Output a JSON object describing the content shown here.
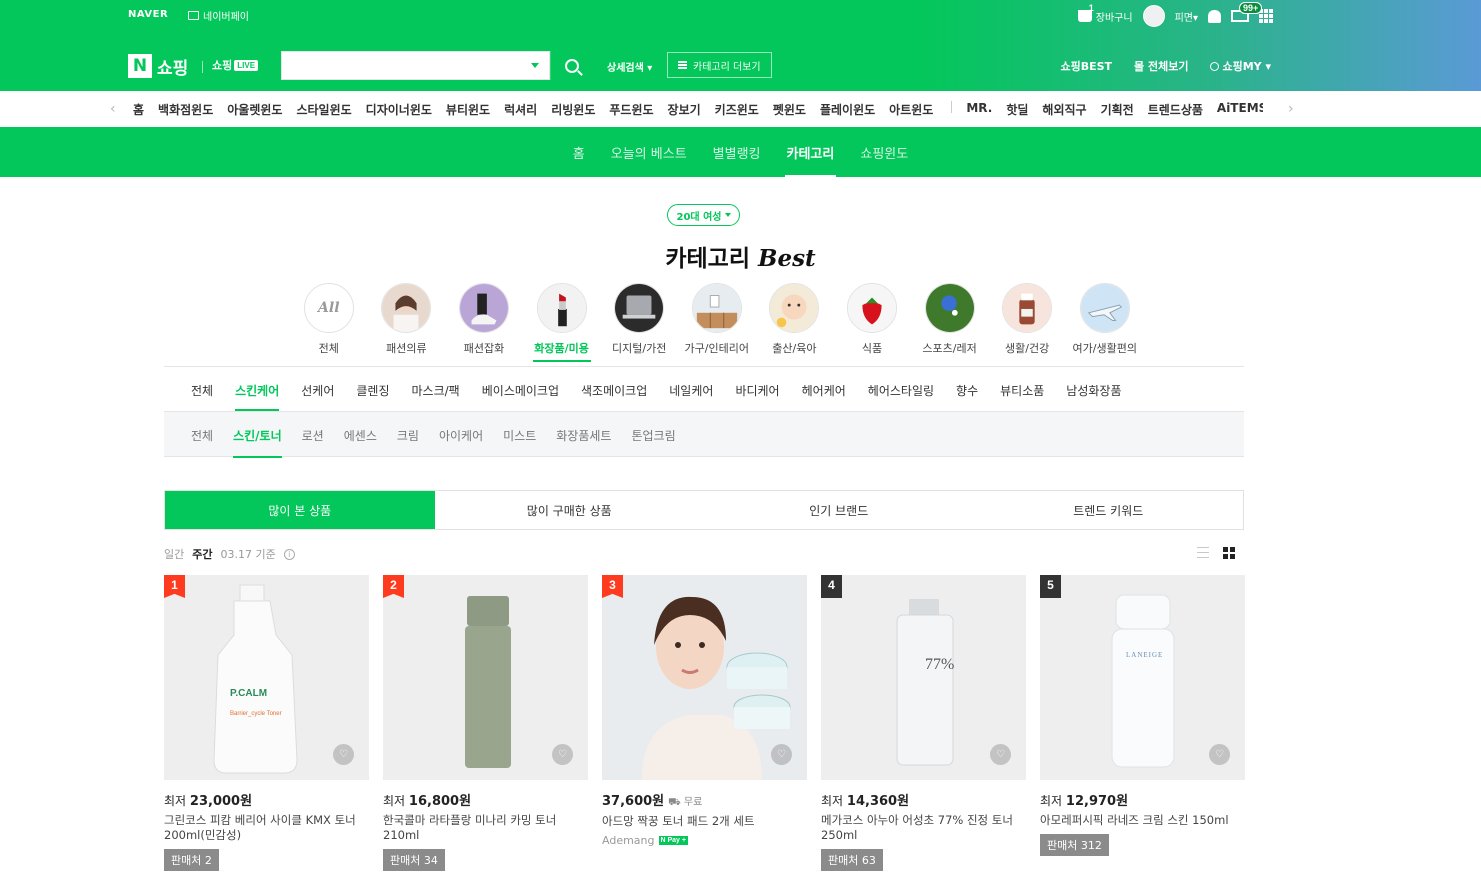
{
  "util_bar": {
    "naver_logo": "NAVER",
    "naver_pay": "네이버페이",
    "cart_label": "장바구니",
    "cart_count": "1",
    "user_name": "피면",
    "mail_badge": "99+"
  },
  "header": {
    "logo_n": "N",
    "logo_text": "쇼핑",
    "live_text": "쇼핑",
    "live_badge": "LIVE",
    "search_value": "",
    "search_placeholder": "",
    "detail_search": "상세검색",
    "category_more": "카테고리 더보기",
    "right_links": [
      "쇼핑BEST",
      "몰 전체보기",
      "쇼핑MY"
    ]
  },
  "window_nav": {
    "items_a": [
      "홈",
      "백화점윈도",
      "아울렛윈도",
      "스타일윈도",
      "디자이너윈도",
      "뷰티윈도",
      "럭셔리",
      "리빙윈도",
      "푸드윈도",
      "장보기",
      "키즈윈도",
      "펫윈도",
      "플레이윈도",
      "아트윈도"
    ],
    "items_b": [
      "MR.",
      "핫딜",
      "해외직구",
      "기획전",
      "트렌드상품",
      "AiTEMS"
    ]
  },
  "subnav": {
    "items": [
      "홈",
      "오늘의 베스트",
      "별별랭킹",
      "카테고리",
      "쇼핑윈도"
    ],
    "active_index": 3
  },
  "filter": {
    "age_group": "20대 여성"
  },
  "title": {
    "ko": "카테고리",
    "en": "Best"
  },
  "categories": [
    {
      "label": "전체",
      "icon": "all-text"
    },
    {
      "label": "패션의류",
      "icon": "fashion-photo"
    },
    {
      "label": "패션잡화",
      "icon": "shoes-photo"
    },
    {
      "label": "화장품/미용",
      "icon": "lipstick-photo"
    },
    {
      "label": "디지털/가전",
      "icon": "laptop-photo"
    },
    {
      "label": "가구/인테리어",
      "icon": "furniture-photo"
    },
    {
      "label": "출산/육아",
      "icon": "baby-photo"
    },
    {
      "label": "식품",
      "icon": "strawberry-photo"
    },
    {
      "label": "스포츠/레저",
      "icon": "golf-photo"
    },
    {
      "label": "생활/건강",
      "icon": "bottle-photo"
    },
    {
      "label": "여가/생활편의",
      "icon": "airplane-photo"
    }
  ],
  "category_all_text": "All",
  "subcategories": [
    "전체",
    "스킨케어",
    "선케어",
    "클렌징",
    "마스크/팩",
    "베이스메이크업",
    "색조메이크업",
    "네일케어",
    "바디케어",
    "헤어케어",
    "헤어스타일링",
    "향수",
    "뷰티소품",
    "남성화장품"
  ],
  "leaf_categories": [
    "전체",
    "스킨/토너",
    "로션",
    "에센스",
    "크림",
    "아이케어",
    "미스트",
    "화장품세트",
    "톤업크림"
  ],
  "tabs": [
    "많이 본 상품",
    "많이 구매한 상품",
    "인기 브랜드",
    "트렌드 키워드"
  ],
  "period": {
    "daily": "일간",
    "weekly": "주간",
    "date": "03.17 기준",
    "info": "i"
  },
  "colors": {
    "brand_green": "#03c75a",
    "rank_red": "#ff3b1f",
    "rank_dark": "#333333"
  },
  "products": [
    {
      "rank": "1",
      "price_prefix": "최저",
      "price": "23,000원",
      "name": "그린코스 피캄 베리어 사이클 KMX 토너 200ml(민감성)",
      "seller": "판매처 2"
    },
    {
      "rank": "2",
      "price_prefix": "최저",
      "price": "16,800원",
      "name": "한국콜마 라타플랑 미나리 카밍 토너 210ml",
      "seller": "판매처 34"
    },
    {
      "rank": "3",
      "price_prefix": "",
      "price": "37,600원",
      "shipping": "무료",
      "name": "아드망 짝꿍 토너 패드 2개 세트",
      "store": "Ademang",
      "pay_badge": "N Pay +"
    },
    {
      "rank": "4",
      "price_prefix": "최저",
      "price": "14,360원",
      "name": "메가코스 아누아 어성초 77% 진정 토너 250ml",
      "seller": "판매처 63"
    },
    {
      "rank": "5",
      "price_prefix": "최저",
      "price": "12,970원",
      "name": "아모레퍼시픽 라네즈 크림 스킨 150ml",
      "seller": "판매처 312"
    }
  ],
  "product_labels": {
    "p1": "P.CALM",
    "p1_sub": "Barrier_cycle Toner",
    "p4": "77%",
    "p5": "LANEIGE"
  }
}
